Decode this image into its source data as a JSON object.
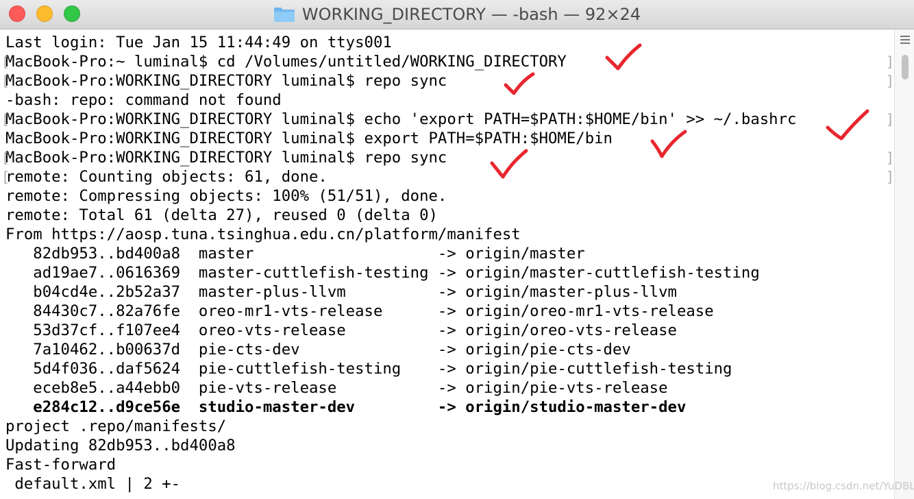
{
  "window": {
    "title": "WORKING_DIRECTORY — -bash — 92×24",
    "folder_icon": "folder-icon"
  },
  "terminal": {
    "lines": [
      "Last login: Tue Jan 15 11:44:49 on ttys001",
      "MacBook-Pro:~ luminal$ cd /Volumes/untitled/WORKING_DIRECTORY",
      "MacBook-Pro:WORKING_DIRECTORY luminal$ repo sync",
      "-bash: repo: command not found",
      "MacBook-Pro:WORKING_DIRECTORY luminal$ echo 'export PATH=$PATH:$HOME/bin' >> ~/.bashrc",
      "MacBook-Pro:WORKING_DIRECTORY luminal$ export PATH=$PATH:$HOME/bin",
      "MacBook-Pro:WORKING_DIRECTORY luminal$ repo sync",
      "remote: Counting objects: 61, done.",
      "remote: Compressing objects: 100% (51/51), done.",
      "remote: Total 61 (delta 27), reused 0 (delta 0)",
      "From https://aosp.tuna.tsinghua.edu.cn/platform/manifest",
      "   82db953..bd400a8  master                    -> origin/master",
      "   ad19ae7..0616369  master-cuttlefish-testing -> origin/master-cuttlefish-testing",
      "   b04cd4e..2b52a37  master-plus-llvm          -> origin/master-plus-llvm",
      "   84430c7..82a76fe  oreo-mr1-vts-release      -> origin/oreo-mr1-vts-release",
      "   53d37cf..f107ee4  oreo-vts-release          -> origin/oreo-vts-release",
      "   7a10462..b00637d  pie-cts-dev               -> origin/pie-cts-dev",
      "   5d4f036..daf5624  pie-cuttlefish-testing    -> origin/pie-cuttlefish-testing",
      "   eceb8e5..a44ebb0  pie-vts-release           -> origin/pie-vts-release",
      "   e284c12..d9ce56e  studio-master-dev         -> origin/studio-master-dev",
      "project .repo/manifests/",
      "Updating 82db953..bd400a8",
      "Fast-forward",
      " default.xml | 2 +-"
    ],
    "bold_line_index": 19,
    "marked_line_indices": [
      1,
      2,
      4,
      6,
      7
    ]
  },
  "annotations": {
    "check_color": "#e8262e",
    "check_icon": "check-mark-icon"
  },
  "watermark": "https://blog.csdn.net/YuDBL"
}
